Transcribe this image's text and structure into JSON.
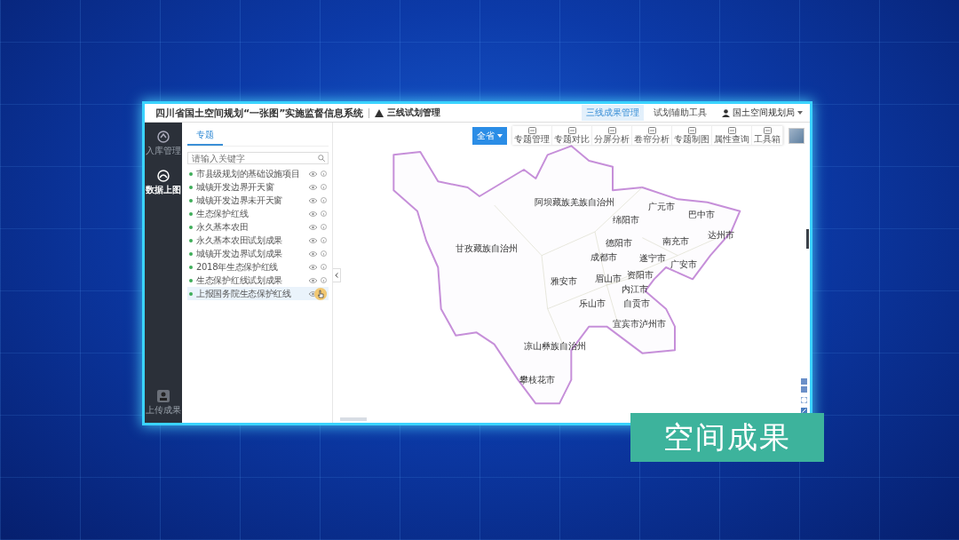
{
  "header": {
    "title": "四川省国土空间规划“一张图”实施监督信息系统",
    "module": {
      "label": "三线试划管理"
    },
    "nav_tabs": [
      {
        "label": "三线成果管理",
        "selected": true
      },
      {
        "label": "试划辅助工具",
        "selected": false
      }
    ],
    "user": {
      "name": "国土空间规划局"
    }
  },
  "sidebar": {
    "items": [
      {
        "label": "入库管理",
        "selected": false
      },
      {
        "label": "数据上图",
        "selected": true
      }
    ],
    "bottom_item": {
      "label": "上传成果"
    }
  },
  "panel": {
    "tabs": [
      {
        "label": "专题",
        "selected": true
      }
    ],
    "search": {
      "placeholder": "请输入关键字"
    },
    "layers": [
      {
        "label": "市县级规划的基础设施项目",
        "selected": false
      },
      {
        "label": "城镇开发边界开天窗",
        "selected": false
      },
      {
        "label": "城镇开发边界未开天窗",
        "selected": false
      },
      {
        "label": "生态保护红线",
        "selected": false
      },
      {
        "label": "永久基本农田",
        "selected": false
      },
      {
        "label": "永久基本农田试划成果",
        "selected": false
      },
      {
        "label": "城镇开发边界试划成果",
        "selected": false
      },
      {
        "label": "2018年生态保护红线",
        "selected": false
      },
      {
        "label": "生态保护红线试划成果",
        "selected": false
      },
      {
        "label": "上报国务院生态保护红线",
        "selected": true
      }
    ]
  },
  "map": {
    "region_button": {
      "label": "全省"
    },
    "tools": [
      {
        "label": "专题管理"
      },
      {
        "label": "专题对比"
      },
      {
        "label": "分屏分析"
      },
      {
        "label": "卷帘分析"
      },
      {
        "label": "专题制图"
      },
      {
        "label": "属性查询"
      },
      {
        "label": "工具箱"
      }
    ],
    "labels": [
      {
        "text": "阿坝藏族羌族自治州"
      },
      {
        "text": "甘孜藏族自治州"
      },
      {
        "text": "广元市"
      },
      {
        "text": "巴中市"
      },
      {
        "text": "绵阳市"
      },
      {
        "text": "达州市"
      },
      {
        "text": "德阳市"
      },
      {
        "text": "南充市"
      },
      {
        "text": "成都市"
      },
      {
        "text": "遂宁市"
      },
      {
        "text": "广安市"
      },
      {
        "text": "雅安市"
      },
      {
        "text": "眉山市"
      },
      {
        "text": "资阳市"
      },
      {
        "text": "内江市"
      },
      {
        "text": "乐山市"
      },
      {
        "text": "自贡市"
      },
      {
        "text": "宜宾市"
      },
      {
        "text": "泸州市"
      },
      {
        "text": "凉山彝族自治州"
      },
      {
        "text": "攀枝花市"
      }
    ]
  },
  "caption": "空间成果"
}
